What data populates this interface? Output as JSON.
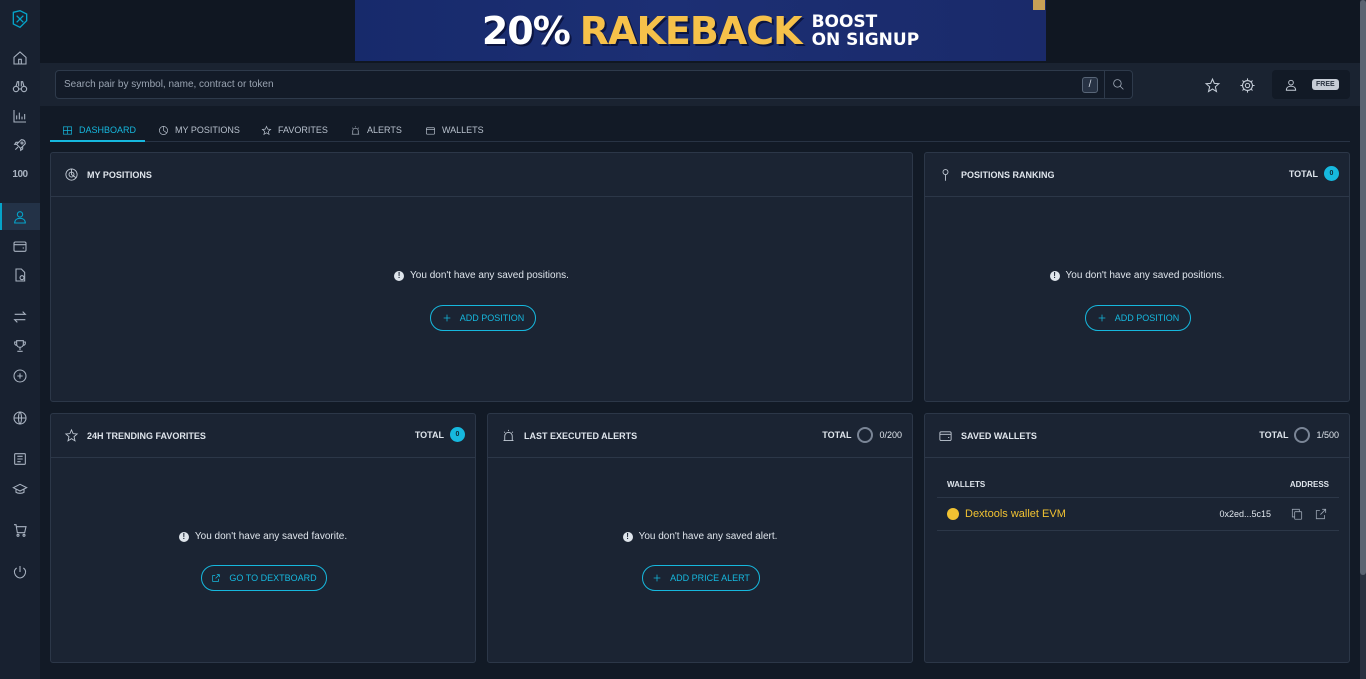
{
  "banner": {
    "big_text": "20%",
    "highlight_text": "RAKEBACK",
    "line1": "BOOST",
    "line2": "ON SIGNUP"
  },
  "search": {
    "placeholder": "Search pair by symbol, name, contract or token",
    "shortcut": "/"
  },
  "user": {
    "plan_badge": "FREE"
  },
  "tabs": [
    {
      "label": "DASHBOARD",
      "icon": "dashboard-icon",
      "active": true
    },
    {
      "label": "MY POSITIONS",
      "icon": "pie-chart-icon",
      "active": false
    },
    {
      "label": "FAVORITES",
      "icon": "star-icon",
      "active": false
    },
    {
      "label": "ALERTS",
      "icon": "alarm-icon",
      "active": false
    },
    {
      "label": "WALLETS",
      "icon": "wallet-icon",
      "active": false
    }
  ],
  "panels": {
    "my_positions": {
      "title": "MY POSITIONS",
      "empty_text": "You don't have any saved positions.",
      "button": "ADD POSITION"
    },
    "positions_ranking": {
      "title": "POSITIONS RANKING",
      "total_label": "TOTAL",
      "total_value": "0",
      "empty_text": "You don't have any saved positions.",
      "button": "ADD POSITION"
    },
    "trending_favorites": {
      "title": "24H TRENDING FAVORITES",
      "total_label": "TOTAL",
      "total_value": "0",
      "empty_text": "You don't have any saved favorite.",
      "button": "GO TO DEXTBOARD"
    },
    "executed_alerts": {
      "title": "LAST EXECUTED ALERTS",
      "total_label": "TOTAL",
      "total_value": "0/200",
      "empty_text": "You don't have any saved alert.",
      "button": "ADD PRICE ALERT"
    },
    "saved_wallets": {
      "title": "SAVED WALLETS",
      "total_label": "TOTAL",
      "total_value": "1/500",
      "col_wallets": "WALLETS",
      "col_address": "ADDRESS",
      "rows": [
        {
          "name": "Dextools wallet EVM",
          "address": "0x2ed...5c15"
        }
      ]
    }
  },
  "colors": {
    "accent": "#16b8de",
    "wallet": "#f1c232",
    "background": "#121a26",
    "panel": "#1b2433"
  }
}
